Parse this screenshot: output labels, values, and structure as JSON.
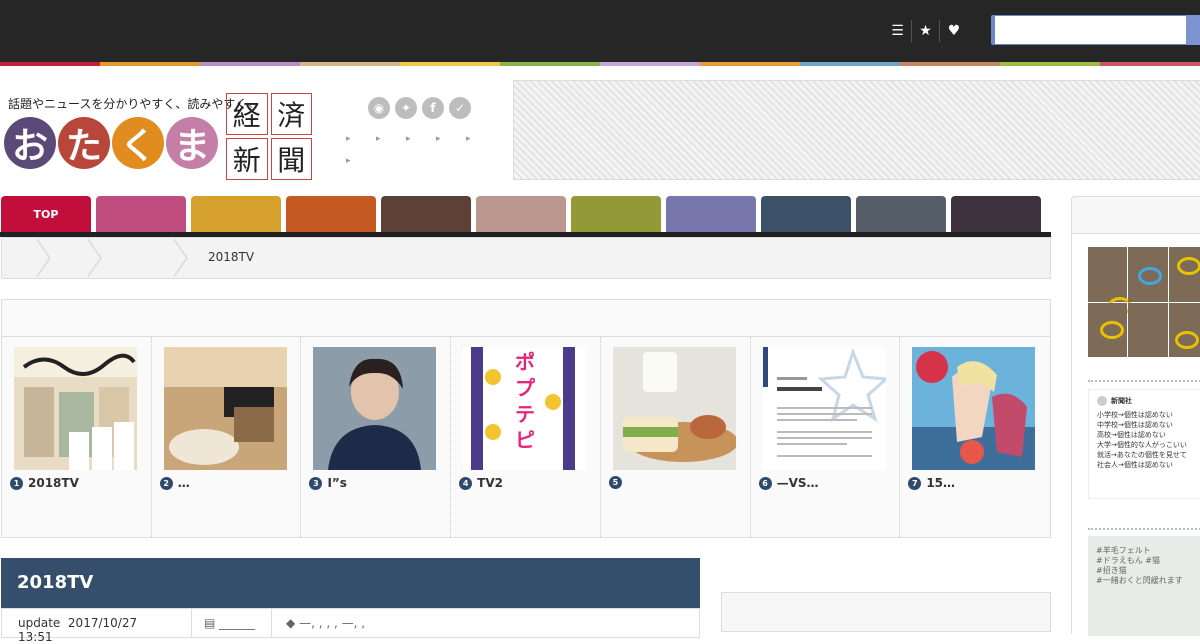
{
  "header": {
    "icons": [
      "list-icon",
      "star-icon",
      "heart-icon"
    ],
    "search_placeholder": ""
  },
  "brand": {
    "tagline": "話題やニュースを分かりやすく、読みやすく。",
    "logo_chars": [
      "お",
      "た",
      "く",
      "ま"
    ],
    "logo_colors": [
      "#5b4a78",
      "#b9463a",
      "#e08c1e",
      "#c47ea7"
    ],
    "kanji": [
      "経",
      "済",
      "新",
      "聞"
    ]
  },
  "social": [
    "rss",
    "twitter",
    "facebook",
    "feedly"
  ],
  "social_glyphs": [
    "◉",
    "✦",
    "f",
    "✓"
  ],
  "color_strip": [
    "#c21f3a",
    "#e39a2c",
    "#b98ec0",
    "#d7b58c",
    "#f2c84b",
    "#8bb14a",
    "#c3a7d8",
    "#e59a3c",
    "#6fa5c9",
    "#c98760",
    "#9cb94a",
    "#c9556a"
  ],
  "nav": {
    "tabs": [
      {
        "label": "TOP",
        "color": "#c20e3b"
      },
      {
        "label": "",
        "color": "#c04c80"
      },
      {
        "label": "",
        "color": "#d5a02c"
      },
      {
        "label": "",
        "color": "#c45a22"
      },
      {
        "label": "",
        "color": "#5e4136"
      },
      {
        "label": "",
        "color": "#bc978f"
      },
      {
        "label": "",
        "color": "#939936"
      },
      {
        "label": "",
        "color": "#7877ad"
      },
      {
        "label": "",
        "color": "#3c5168"
      },
      {
        "label": "",
        "color": "#565f69"
      },
      {
        "label": "",
        "color": "#3f323f"
      }
    ]
  },
  "breadcrumb": {
    "current": "2018TV"
  },
  "ranking": {
    "items": [
      {
        "num": "1",
        "title": "2018TV"
      },
      {
        "num": "2",
        "title": "…"
      },
      {
        "num": "3",
        "title": "I”s"
      },
      {
        "num": "4",
        "title": "TV2"
      },
      {
        "num": "5",
        "title": ""
      },
      {
        "num": "6",
        "title": "—VS…"
      },
      {
        "num": "7",
        "title": "15…"
      }
    ]
  },
  "article": {
    "title": "2018TV",
    "update_label": "update",
    "update_date": "2017/10/27 13:51",
    "category": "______",
    "tags": "—, , , , —, ,"
  },
  "sidebar": {
    "tweet_lines": [
      "小学校→個性は認めない",
      "中学校→個性は認めない",
      "高校→個性は認めない",
      "大学→個性的な人がっこいい",
      "就活→あなたの個性を見せて",
      "社会人→個性は認めない"
    ],
    "tweet_name": "新聞社",
    "img2_lines": [
      "#羊毛フェルト",
      "#ドラえもん #猫",
      "#招き猫",
      "#一緒おくと閃緩れます"
    ]
  }
}
